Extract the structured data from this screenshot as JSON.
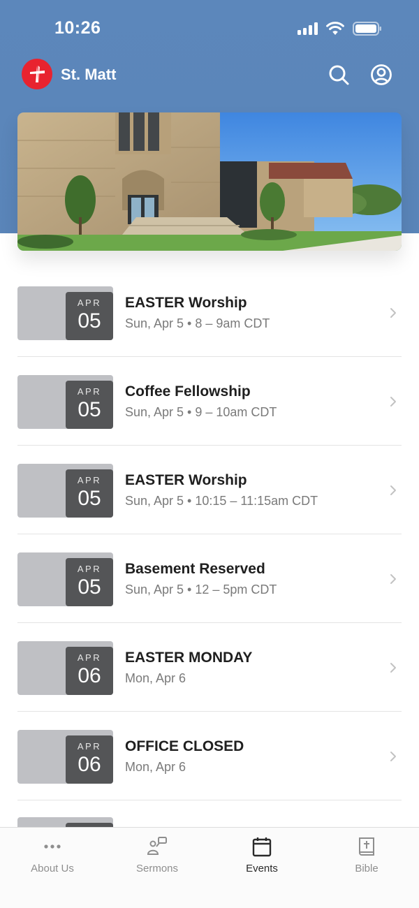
{
  "status_bar": {
    "time": "10:26"
  },
  "header": {
    "church_name": "St. Matt",
    "icons": [
      "cross-logo-icon",
      "search-icon",
      "account-icon"
    ]
  },
  "events": [
    {
      "month": "APR",
      "day": "05",
      "title": "EASTER Worship",
      "subtitle": "Sun, Apr 5 • 8 – 9am CDT"
    },
    {
      "month": "APR",
      "day": "05",
      "title": "Coffee Fellowship",
      "subtitle": "Sun, Apr 5 • 9 – 10am CDT"
    },
    {
      "month": "APR",
      "day": "05",
      "title": "EASTER Worship",
      "subtitle": "Sun, Apr 5 • 10:15 – 11:15am CDT"
    },
    {
      "month": "APR",
      "day": "05",
      "title": "Basement Reserved",
      "subtitle": "Sun, Apr 5 • 12 – 5pm CDT"
    },
    {
      "month": "APR",
      "day": "06",
      "title": "EASTER MONDAY",
      "subtitle": "Mon, Apr 6"
    },
    {
      "month": "APR",
      "day": "06",
      "title": "OFFICE CLOSED",
      "subtitle": "Mon, Apr 6"
    }
  ],
  "tabs": [
    {
      "label": "About Us",
      "icon": "more-dots-icon",
      "active": false
    },
    {
      "label": "Sermons",
      "icon": "sermons-icon",
      "active": false
    },
    {
      "label": "Events",
      "icon": "calendar-icon",
      "active": true
    },
    {
      "label": "Bible",
      "icon": "bible-icon",
      "active": false
    }
  ],
  "colors": {
    "header_blue": "#5a85b9",
    "logo_red": "#e8232f",
    "date_badge": "#545557",
    "date_card": "#bfc0c4",
    "active_tab": "#2a2a2a",
    "inactive_tab": "#8e8e8e"
  }
}
